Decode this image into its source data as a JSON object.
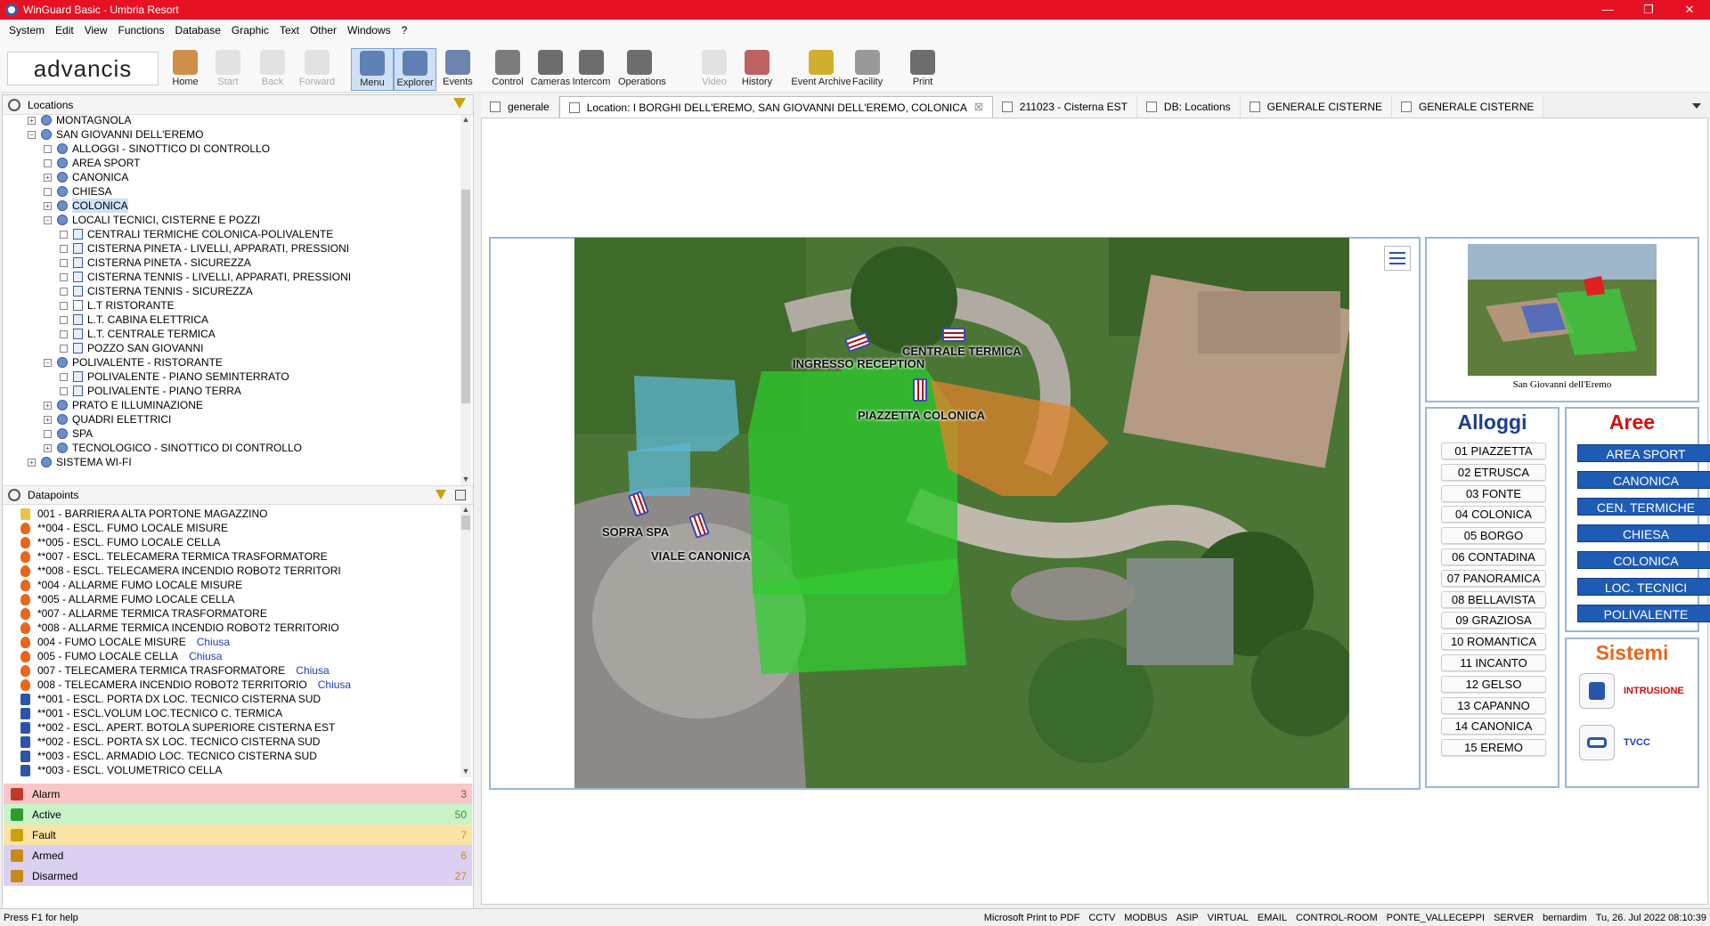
{
  "window": {
    "title": "WinGuard Basic - Umbria Resort"
  },
  "menu": [
    "System",
    "Edit",
    "View",
    "Functions",
    "Database",
    "Graphic",
    "Text",
    "Other",
    "Windows",
    "?"
  ],
  "logo": "advancis",
  "toolbar": [
    {
      "label": "Home",
      "state": "normal"
    },
    {
      "label": "Start",
      "state": "disabled"
    },
    {
      "label": "Back",
      "state": "disabled"
    },
    {
      "label": "Forward",
      "state": "disabled"
    },
    {
      "label": "Menu",
      "state": "active"
    },
    {
      "label": "Explorer",
      "state": "active"
    },
    {
      "label": "Events",
      "state": "normal"
    },
    {
      "label": "Control",
      "state": "normal"
    },
    {
      "label": "Cameras",
      "state": "normal"
    },
    {
      "label": "Intercom",
      "state": "normal"
    },
    {
      "label": "Operations",
      "state": "normal"
    },
    {
      "label": "Video",
      "state": "disabled"
    },
    {
      "label": "History",
      "state": "normal"
    },
    {
      "label": "Event Archive",
      "state": "normal"
    },
    {
      "label": "Facility",
      "state": "normal"
    },
    {
      "label": "Print",
      "state": "normal"
    }
  ],
  "locations": {
    "title": "Locations",
    "items": [
      {
        "label": "MONTAGNOLA",
        "level": 0,
        "exp": "+",
        "icon": "group"
      },
      {
        "label": "SAN GIOVANNI DELL'EREMO",
        "level": 0,
        "exp": "-",
        "icon": "group"
      },
      {
        "label": "ALLOGGI - SINOTTICO DI CONTROLLO",
        "level": 1,
        "exp": "",
        "icon": "group"
      },
      {
        "label": "AREA SPORT",
        "level": 1,
        "exp": "",
        "icon": "group"
      },
      {
        "label": "CANONICA",
        "level": 1,
        "exp": "+",
        "icon": "group"
      },
      {
        "label": "CHIESA",
        "level": 1,
        "exp": "",
        "icon": "group"
      },
      {
        "label": "COLONICA",
        "level": 1,
        "exp": "+",
        "icon": "group",
        "selected": true
      },
      {
        "label": "LOCALI TECNICI, CISTERNE E POZZI",
        "level": 1,
        "exp": "-",
        "icon": "group"
      },
      {
        "label": "CENTRALI TERMICHE COLONICA-POLIVALENTE",
        "level": 2,
        "exp": "",
        "icon": "map"
      },
      {
        "label": "CISTERNA PINETA - LIVELLI, APPARATI, PRESSIONI",
        "level": 2,
        "exp": "",
        "icon": "map"
      },
      {
        "label": "CISTERNA PINETA - SICUREZZA",
        "level": 2,
        "exp": "",
        "icon": "map"
      },
      {
        "label": "CISTERNA TENNIS - LIVELLI, APPARATI, PRESSIONI",
        "level": 2,
        "exp": "",
        "icon": "map"
      },
      {
        "label": "CISTERNA TENNIS - SICUREZZA",
        "level": 2,
        "exp": "",
        "icon": "map"
      },
      {
        "label": "L.T RISTORANTE",
        "level": 2,
        "exp": "",
        "icon": "page"
      },
      {
        "label": "L.T. CABINA ELETTRICA",
        "level": 2,
        "exp": "",
        "icon": "map"
      },
      {
        "label": "L.T. CENTRALE TERMICA",
        "level": 2,
        "exp": "",
        "icon": "map"
      },
      {
        "label": "POZZO SAN GIOVANNI",
        "level": 2,
        "exp": "",
        "icon": "map"
      },
      {
        "label": "POLIVALENTE - RISTORANTE",
        "level": 1,
        "exp": "-",
        "icon": "group"
      },
      {
        "label": "POLIVALENTE - PIANO SEMINTERRATO",
        "level": 2,
        "exp": "",
        "icon": "map"
      },
      {
        "label": "POLIVALENTE - PIANO TERRA",
        "level": 2,
        "exp": "",
        "icon": "map"
      },
      {
        "label": "PRATO E ILLUMINAZIONE",
        "level": 1,
        "exp": "+",
        "icon": "group"
      },
      {
        "label": "QUADRI ELETTRICI",
        "level": 1,
        "exp": "+",
        "icon": "group"
      },
      {
        "label": "SPA",
        "level": 1,
        "exp": "",
        "icon": "group"
      },
      {
        "label": "TECNOLOGICO - SINOTTICO DI CONTROLLO",
        "level": 1,
        "exp": "+",
        "icon": "group"
      },
      {
        "label": "SISTEMA WI-FI",
        "level": 0,
        "exp": "+",
        "icon": "group"
      }
    ]
  },
  "datapoints": {
    "title": "Datapoints",
    "items": [
      {
        "label": "001 - BARRIERA ALTA PORTONE MAGAZZINO",
        "icon": "folder",
        "state": ""
      },
      {
        "label": "**004 - ESCL. FUMO LOCALE MISURE",
        "icon": "fire",
        "state": ""
      },
      {
        "label": "**005 - ESCL. FUMO LOCALE CELLA",
        "icon": "fire",
        "state": ""
      },
      {
        "label": "**007 - ESCL. TELECAMERA TERMICA TRASFORMATORE",
        "icon": "fire",
        "state": ""
      },
      {
        "label": "**008 - ESCL. TELECAMERA INCENDIO ROBOT2 TERRITORI",
        "icon": "fire",
        "state": ""
      },
      {
        "label": "*004 - ALLARME FUMO LOCALE MISURE",
        "icon": "fire",
        "state": ""
      },
      {
        "label": "*005 - ALLARME FUMO LOCALE CELLA",
        "icon": "fire",
        "state": ""
      },
      {
        "label": "*007 - ALLARME TERMICA TRASFORMATORE",
        "icon": "fire",
        "state": ""
      },
      {
        "label": "*008 - ALLARME TERMICA INCENDIO ROBOT2 TERRITORIO",
        "icon": "fire",
        "state": ""
      },
      {
        "label": "004 - FUMO LOCALE MISURE",
        "icon": "fire",
        "state": "Chiusa"
      },
      {
        "label": "005 - FUMO LOCALE CELLA",
        "icon": "fire",
        "state": "Chiusa"
      },
      {
        "label": "007 - TELECAMERA TERMICA TRASFORMATORE",
        "icon": "fire",
        "state": "Chiusa"
      },
      {
        "label": "008 - TELECAMERA INCENDIO ROBOT2 TERRITORIO",
        "icon": "fire",
        "state": "Chiusa"
      },
      {
        "label": "**001 - ESCL. PORTA DX LOC. TECNICO CISTERNA SUD",
        "icon": "intrusion",
        "state": ""
      },
      {
        "label": "**001 - ESCL.VOLUM LOC.TECNICO C. TERMICA",
        "icon": "intrusion",
        "state": ""
      },
      {
        "label": "**002 - ESCL. APERT. BOTOLA SUPERIORE CISTERNA EST",
        "icon": "intrusion",
        "state": ""
      },
      {
        "label": "**002 - ESCL. PORTA SX LOC. TECNICO CISTERNA SUD",
        "icon": "intrusion",
        "state": ""
      },
      {
        "label": "**003 - ESCL. ARMADIO  LOC. TECNICO CISTERNA SUD",
        "icon": "intrusion",
        "state": ""
      },
      {
        "label": "**003 - ESCL. VOLUMETRICO CELLA",
        "icon": "intrusion",
        "state": ""
      }
    ]
  },
  "status": [
    {
      "label": "Alarm",
      "count": "3",
      "bg": "#f9c7c7",
      "color": "#c0392b"
    },
    {
      "label": "Active",
      "count": "50",
      "bg": "#c9f2c9",
      "color": "#2e9b2e"
    },
    {
      "label": "Fault",
      "count": "7",
      "bg": "#fbe3a6",
      "color": "#c9a20a"
    },
    {
      "label": "Armed",
      "count": "6",
      "bg": "#dcd0f2",
      "color": "#c98a14"
    },
    {
      "label": "Disarmed",
      "count": "27",
      "bg": "#dcd0f2",
      "color": "#c98a14"
    }
  ],
  "tabs": [
    {
      "label": "generale",
      "active": false
    },
    {
      "label": "Location: I BORGHI DELL'EREMO, SAN GIOVANNI DELL'EREMO, COLONICA",
      "active": true,
      "close": "☒"
    },
    {
      "label": "211023 - Cisterna EST",
      "active": false
    },
    {
      "label": "DB: Locations",
      "active": false
    },
    {
      "label": "GENERALE CISTERNE",
      "active": false
    },
    {
      "label": "GENERALE CISTERNE",
      "active": false
    }
  ],
  "map": {
    "labels": [
      "INGRESSO RECEPTION",
      "CENTRALE TERMICA",
      "PIAZZETTA COLONICA",
      "SOPRA SPA",
      "VIALE CANONICA"
    ]
  },
  "thumbnail": {
    "caption": "San Giovanni dell'Eremo"
  },
  "alloggi": {
    "title": "Alloggi",
    "items": [
      "01 PIAZZETTA",
      "02 ETRUSCA",
      "03 FONTE",
      "04 COLONICA",
      "05 BORGO",
      "06 CONTADINA",
      "07 PANORAMICA",
      "08 BELLAVISTA",
      "09 GRAZIOSA",
      "10 ROMANTICA",
      "11 INCANTO",
      "12 GELSO",
      "13 CAPANNO",
      "14 CANONICA",
      "15 EREMO"
    ]
  },
  "aree": {
    "title": "Aree",
    "items": [
      "AREA SPORT",
      "CANONICA",
      "CEN. TERMICHE",
      "CHIESA",
      "COLONICA",
      "LOC. TECNICI",
      "POLIVALENTE"
    ]
  },
  "sistemi": {
    "title": "Sistemi",
    "items": [
      {
        "label": "INTRUSIONE",
        "color": "#d01010"
      },
      {
        "label": "TVCC",
        "color": "#1a3fb5"
      }
    ]
  },
  "statusbar": {
    "help": "Press F1 for help",
    "items": [
      "Microsoft Print to PDF",
      "CCTV",
      "MODBUS",
      "ASIP",
      "VIRTUAL",
      "EMAIL",
      "CONTROL-ROOM",
      "PONTE_VALLECEPPI",
      "SERVER",
      "bernardim",
      "Tu, 26. Jul 2022   08:10:39"
    ]
  },
  "colors": {
    "titlebar": "#e81123",
    "accent": "#1e5bb5",
    "panel_border": "#9bb6d6",
    "alloggi_title": "#1a3f8f",
    "aree_title": "#d01010",
    "sistemi_title": "#e8661a"
  }
}
